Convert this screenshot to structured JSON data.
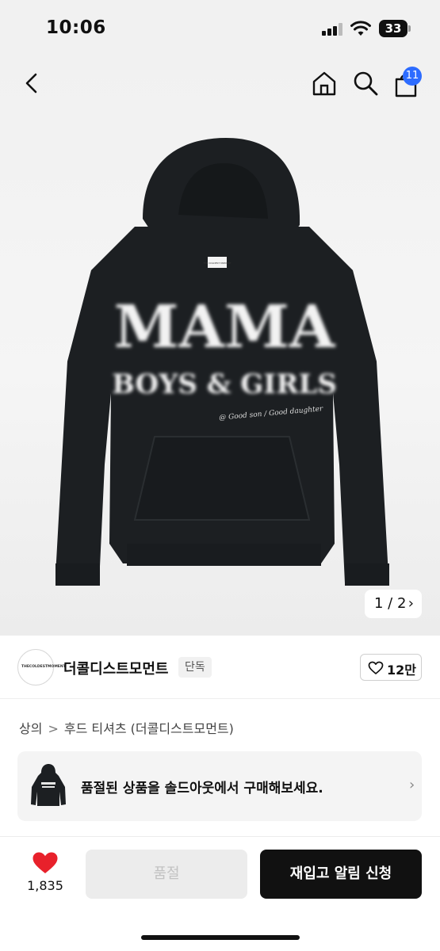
{
  "status_bar": {
    "time": "10:06",
    "battery": "33"
  },
  "nav": {
    "cart_count": "11"
  },
  "image_counter": {
    "text": "1 / 2",
    "chevron": "›"
  },
  "product_art": {
    "title": "MAMA",
    "subtitle": "BOYS & GIRLS",
    "tagline": "@ Good son / Good daughter",
    "label": "THE COLDEST MOMENT"
  },
  "brand": {
    "logo_text": "THECOLDESTMOMENT",
    "name": "더콜디스트모먼트",
    "tag": "단독",
    "like_count": "12만"
  },
  "breadcrumb": {
    "items": [
      "상의",
      "후드 티셔츠 (더콜디스트모먼트)"
    ],
    "separator": ">"
  },
  "soldout_banner": {
    "text": "품절된 상품을 솔드아웃에서 구매해보세요.",
    "chevron": "›"
  },
  "bottom_bar": {
    "price_peek": "",
    "wish_count": "1,835",
    "soldout_label": "품절",
    "restock_label": "재입고 알림 신청"
  },
  "colors": {
    "accent_blue": "#2d6cff",
    "wish_red": "#e8212b",
    "primary_button": "#111111",
    "hoodie": "#1c1f22"
  },
  "icons": [
    "back-icon",
    "home-icon",
    "search-icon",
    "cart-icon",
    "heart-outline-icon",
    "heart-filled-icon",
    "chevron-right-icon"
  ]
}
